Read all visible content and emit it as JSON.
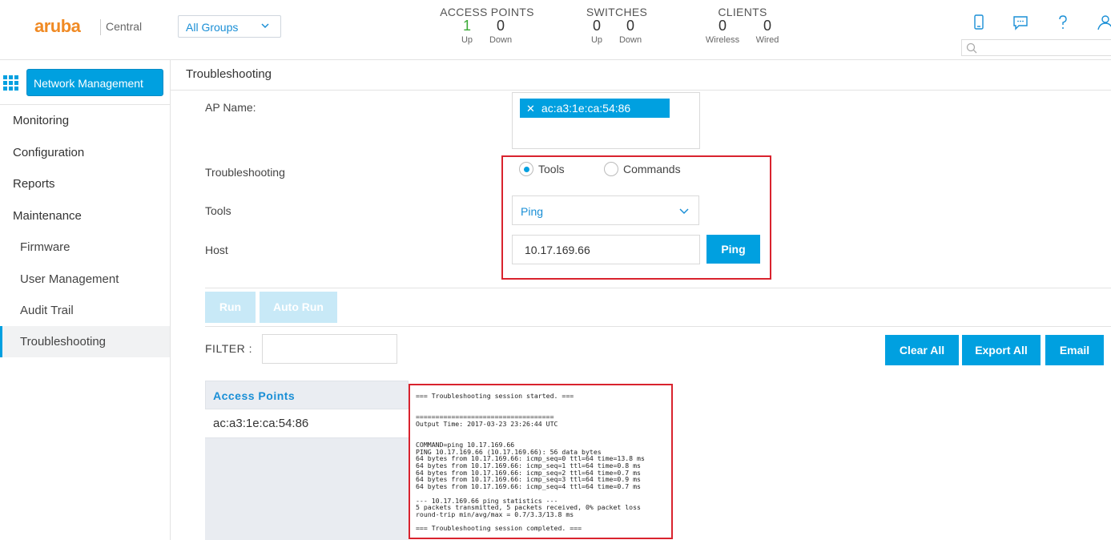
{
  "header": {
    "logo": "aruba",
    "logo_sub": "Central",
    "group_select": "All Groups",
    "stats": {
      "access_points": {
        "title": "ACCESS POINTS",
        "up": "1",
        "down": "0",
        "up_label": "Up",
        "down_label": "Down"
      },
      "switches": {
        "title": "SWITCHES",
        "up": "0",
        "down": "0",
        "up_label": "Up",
        "down_label": "Down"
      },
      "clients": {
        "title": "CLIENTS",
        "wireless": "0",
        "wired": "0",
        "wireless_label": "Wireless",
        "wired_label": "Wired"
      }
    },
    "accent_green": "#3aa935"
  },
  "sidebar": {
    "app_button": "Network Management",
    "items": [
      "Monitoring",
      "Configuration",
      "Reports",
      "Maintenance"
    ],
    "sub_items": [
      "Firmware",
      "User Management",
      "Audit Trail",
      "Troubleshooting"
    ],
    "active": "Troubleshooting"
  },
  "main": {
    "title": "Troubleshooting",
    "ap_name_label": "AP Name:",
    "ap_tag": "ac:a3:1e:ca:54:86",
    "troubleshooting_label": "Troubleshooting",
    "radio_tools": "Tools",
    "radio_commands": "Commands",
    "tools_label": "Tools",
    "tools_value": "Ping",
    "host_label": "Host",
    "host_value": "10.17.169.66",
    "ping_button": "Ping",
    "run_button": "Run",
    "auto_run_button": "Auto Run",
    "filter_label": "FILTER :",
    "clear_all": "Clear All",
    "export_all": "Export All",
    "email": "Email",
    "ap_panel_header": "Access Points",
    "ap_panel_row": "ac:a3:1e:ca:54:86",
    "output": "=== Troubleshooting session started. ===\n\n\n===================================\nOutput Time: 2017-03-23 23:26:44 UTC\n\n\nCOMMAND=ping 10.17.169.66\nPING 10.17.169.66 (10.17.169.66): 56 data bytes\n64 bytes from 10.17.169.66: icmp_seq=0 ttl=64 time=13.8 ms\n64 bytes from 10.17.169.66: icmp_seq=1 ttl=64 time=0.8 ms\n64 bytes from 10.17.169.66: icmp_seq=2 ttl=64 time=0.7 ms\n64 bytes from 10.17.169.66: icmp_seq=3 ttl=64 time=0.9 ms\n64 bytes from 10.17.169.66: icmp_seq=4 ttl=64 time=0.7 ms\n\n--- 10.17.169.66 ping statistics ---\n5 packets transmitted, 5 packets received, 0% packet loss\nround-trip min/avg/max = 0.7/3.3/13.8 ms\n\n=== Troubleshooting session completed. ==="
  },
  "colors": {
    "accent": "#00a0e0",
    "highlight_box": "#d9232e",
    "logo": "#f08a24"
  }
}
